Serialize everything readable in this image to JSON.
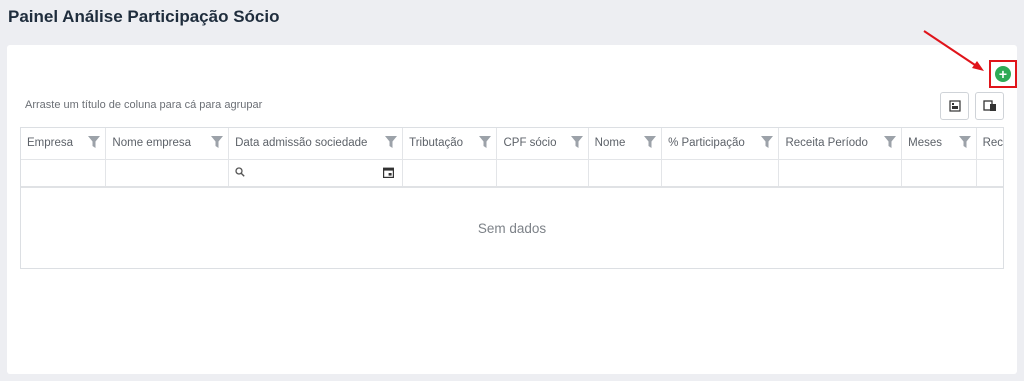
{
  "page": {
    "title": "Painel Análise Participação Sócio"
  },
  "toolbar": {
    "group_hint": "Arraste um título de coluna para cá para agrupar",
    "add_icon": "plus-circle-icon",
    "export_icon": "export-excel-icon",
    "chooser_icon": "column-chooser-icon",
    "accent_color": "#2eaa56",
    "highlight_color": "#e0141b"
  },
  "grid": {
    "columns": [
      {
        "label": "Empresa"
      },
      {
        "label": "Nome empresa"
      },
      {
        "label": "Data admissão sociedade"
      },
      {
        "label": "Tributação"
      },
      {
        "label": "CPF sócio"
      },
      {
        "label": "Nome"
      },
      {
        "label": "% Participação"
      },
      {
        "label": "Receita Período"
      },
      {
        "label": "Meses"
      },
      {
        "label": "Receita Prev"
      }
    ],
    "empty_text": "Sem dados"
  }
}
